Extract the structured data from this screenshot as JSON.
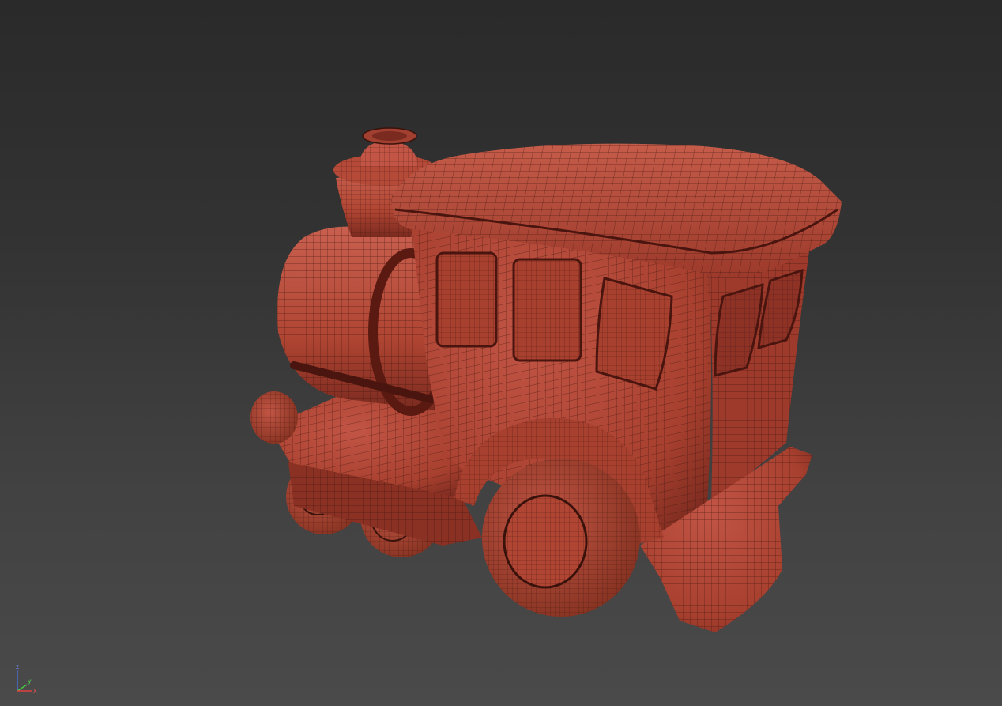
{
  "viewport": {
    "background_top": "#2a2a2a",
    "background_bottom": "#4a4a4a",
    "model_color": "#b84a3a",
    "wire_color": "#3a120c"
  },
  "axis_gizmo": {
    "z_label": "z",
    "y_label": "y",
    "x_label": "x",
    "z_color": "#4a6cd0",
    "y_color": "#45c845",
    "x_color": "#e04040"
  }
}
